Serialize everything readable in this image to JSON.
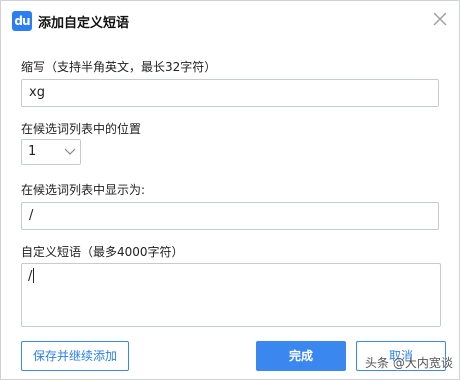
{
  "dialog": {
    "logo_text": "du",
    "title": "添加自定义短语",
    "close_icon": "close-icon"
  },
  "abbreviation": {
    "label": "缩写（支持半角英文，最长32字符）",
    "value": "xg"
  },
  "position": {
    "label": "在候选词列表中的位置",
    "selected": "1"
  },
  "display": {
    "label": "在候选词列表中显示为:",
    "value": "/"
  },
  "phrase": {
    "label": "自定义短语（最多4000字符）",
    "value": "/"
  },
  "buttons": {
    "save_continue": "保存并继续添加",
    "ok": "完成",
    "cancel": "取消"
  },
  "watermark": "头条 @大内宽谈",
  "colors": {
    "accent": "#3b87f0",
    "border": "#c6cbd2"
  }
}
